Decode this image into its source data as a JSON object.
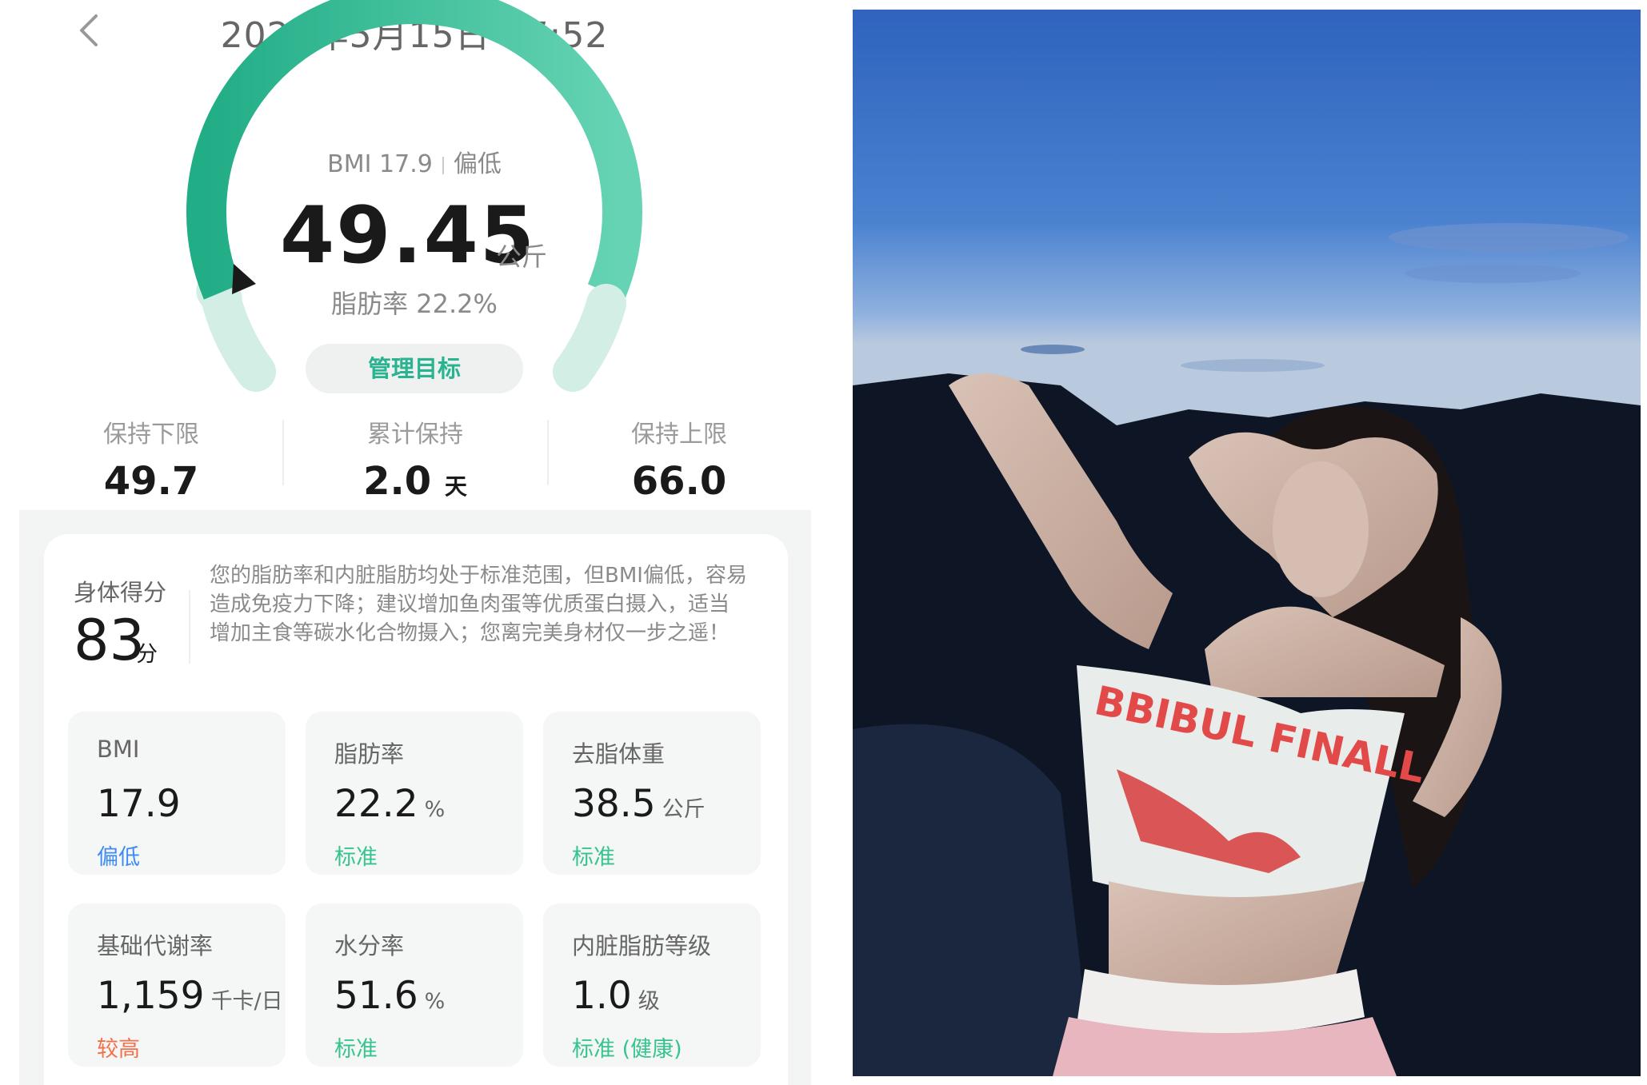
{
  "header": {
    "date": "2025年5月15日 07:52",
    "back_icon": "chevron-left-icon"
  },
  "gauge": {
    "bmi_text": "BMI 17.9",
    "bmi_status": "偏低",
    "weight": "49.45",
    "weight_unit": "公斤",
    "fat_text": "脂肪率 22.2%",
    "goal_button": "管理目标",
    "colors": {
      "arc_dark": "#2bb98f",
      "arc_light": "#d2eee5",
      "marker": "#1a1a1a"
    }
  },
  "keep": [
    {
      "label": "保持下限",
      "value": "49.7",
      "unit": ""
    },
    {
      "label": "累计保持",
      "value": "2.0",
      "unit": "天"
    },
    {
      "label": "保持上限",
      "value": "66.0",
      "unit": ""
    }
  ],
  "body_score": {
    "label": "身体得分",
    "value": "83",
    "unit": "分",
    "advice": "您的脂肪率和内脏脂肪均处于标准范围，但BMI偏低，容易造成免疫力下降；建议增加鱼肉蛋等优质蛋白摄入，适当增加主食等碳水化合物摄入；您离完美身材仅一步之遥！"
  },
  "metrics": [
    {
      "label": "BMI",
      "value": "17.9",
      "unit": "",
      "status": "偏低",
      "status_color": "#3f8cf2"
    },
    {
      "label": "脂肪率",
      "value": "22.2",
      "unit": "%",
      "status": "标准",
      "status_color": "#37c48c"
    },
    {
      "label": "去脂体重",
      "value": "38.5",
      "unit": "公斤",
      "status": "标准",
      "status_color": "#37c48c"
    },
    {
      "label": "基础代谢率",
      "value": "1,159",
      "unit": "千卡/日",
      "status": "较高",
      "status_color": "#f2704a"
    },
    {
      "label": "水分率",
      "value": "51.6",
      "unit": "%",
      "status": "标准",
      "status_color": "#37c48c"
    },
    {
      "label": "内脏脂肪等级",
      "value": "1.0",
      "unit": "级",
      "status": "标准 (健康)",
      "status_color": "#37c48c"
    }
  ],
  "photo": {
    "subject": "woman-making-heart-hands-at-dusk",
    "shirt_text": "BBIBUL FINALL",
    "sky_top": "#3a6fc6",
    "sky_bottom": "#a9c6e8"
  }
}
